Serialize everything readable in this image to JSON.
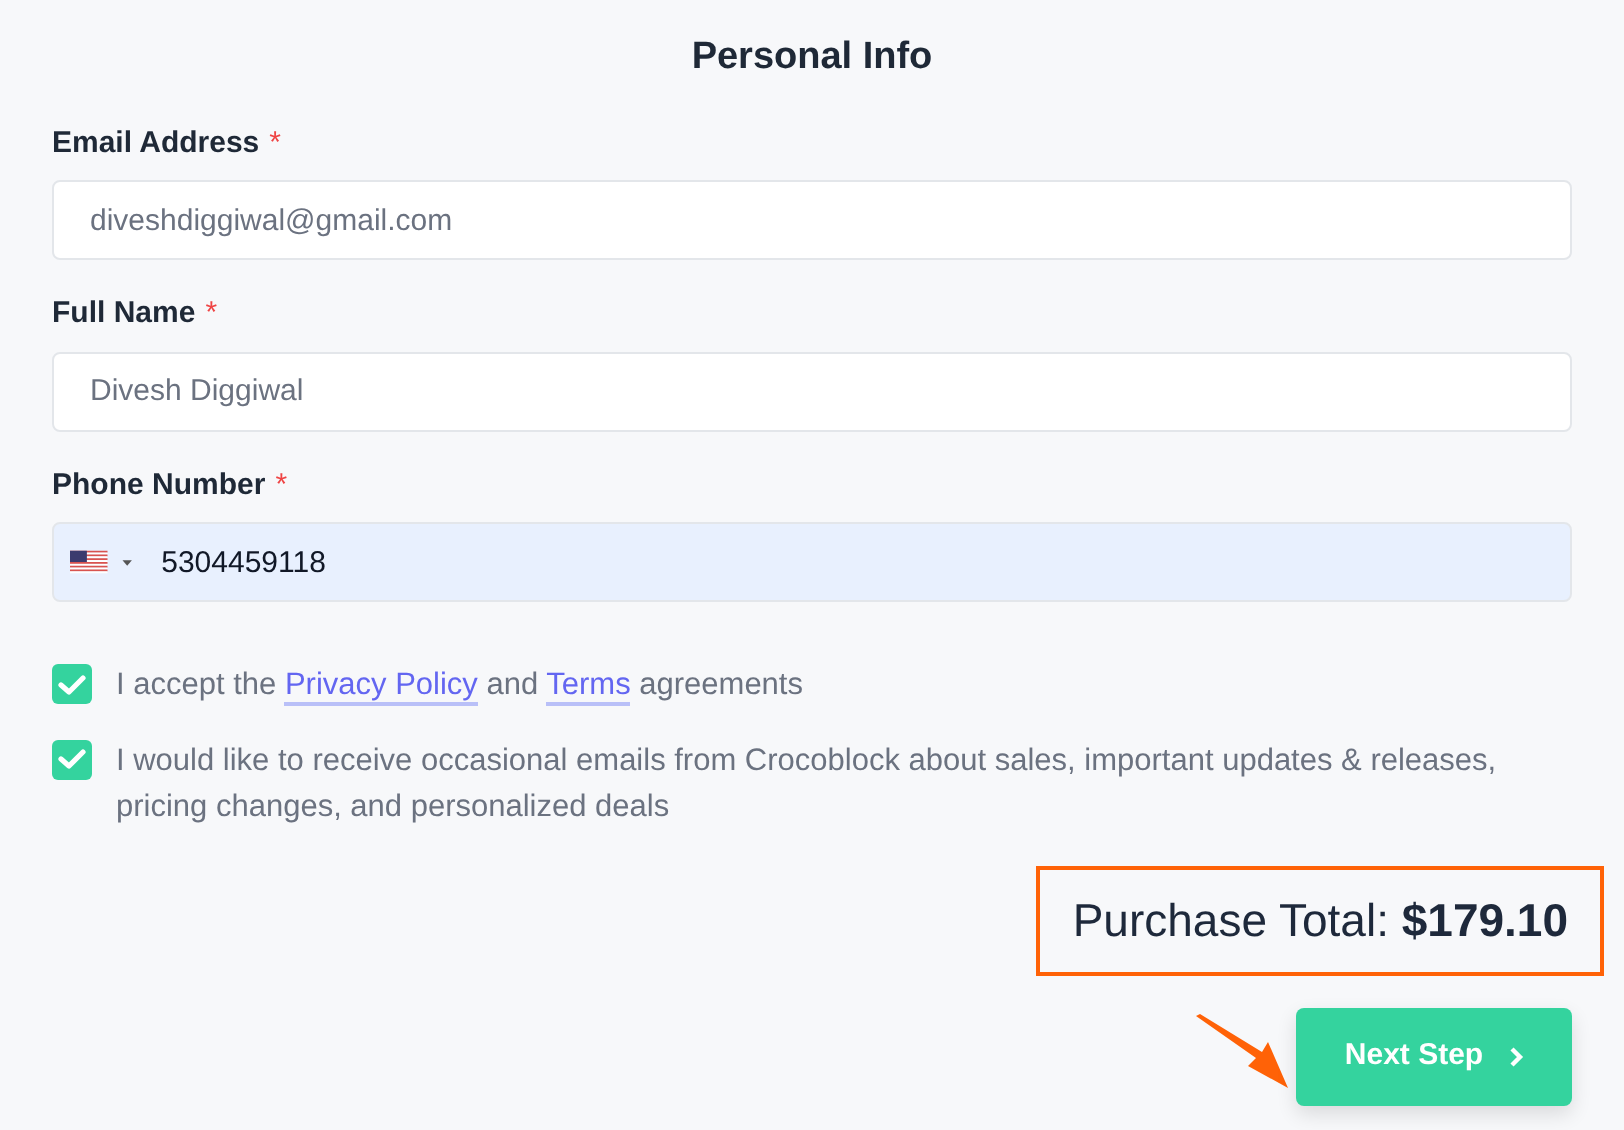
{
  "title": "Personal Info",
  "fields": [
    {
      "kind": "text",
      "label": "Email Address",
      "required": true,
      "required_mark": "*",
      "value": "diveshdiggiwal@gmail.com",
      "autofilled": false
    },
    {
      "kind": "text",
      "label": "Full Name",
      "required": true,
      "required_mark": "*",
      "value": "Divesh Diggiwal",
      "autofilled": false
    },
    {
      "kind": "phone",
      "label": "Phone Number",
      "required": true,
      "required_mark": "*",
      "value": "5304459118",
      "autofilled": true
    }
  ],
  "checkboxes": [
    {
      "checked": true,
      "parts": [
        {
          "kind": "text",
          "text": "I accept the "
        },
        {
          "kind": "link",
          "text": "Privacy Policy"
        },
        {
          "kind": "text",
          "text": " and "
        },
        {
          "kind": "link",
          "text": "Terms"
        },
        {
          "kind": "text",
          "text": " agreements"
        }
      ]
    },
    {
      "checked": true,
      "parts": [
        {
          "kind": "text",
          "text": "I would like to receive occasional emails from Crocoblock about sales, important updates & releases, pricing changes, and personalized deals"
        }
      ]
    }
  ],
  "total": {
    "text": "Purchase Total: **$179.10**",
    "highlighted": true
  },
  "next_button": {
    "label": "Next Step",
    "pointed_at": true
  }
}
